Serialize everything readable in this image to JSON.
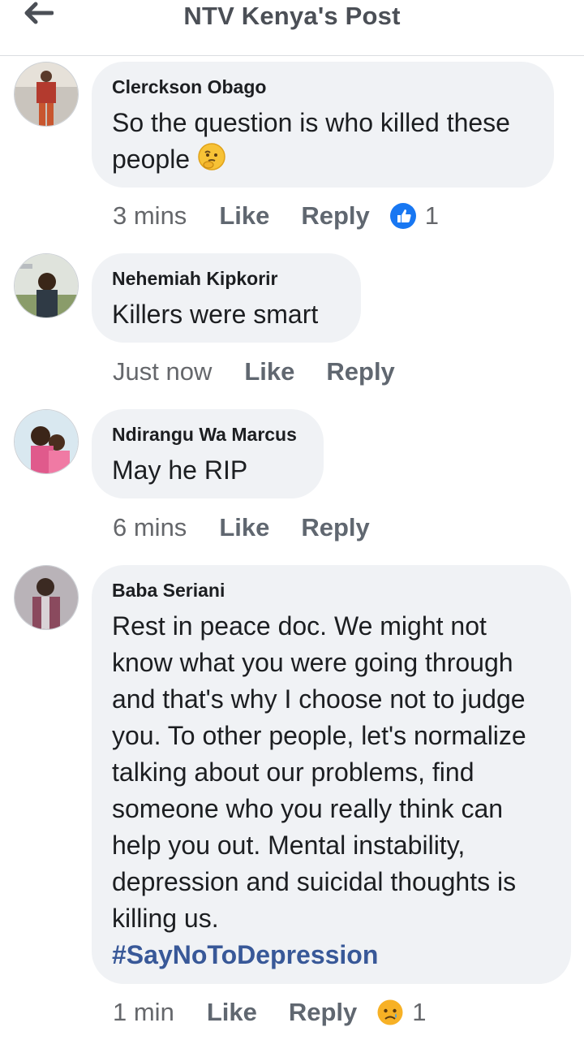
{
  "header": {
    "title": "NTV Kenya's Post",
    "back_icon": "arrow-left-icon"
  },
  "comments": [
    {
      "author": "Clerckson Obago",
      "text": "So the question is who killed these people",
      "emoji": "thinking-face-icon",
      "time": "3 mins",
      "like": "Like",
      "reply": "Reply",
      "reaction": {
        "icon": "like-icon",
        "count": "1",
        "color": "#1877f2"
      }
    },
    {
      "author": "Nehemiah Kipkorir",
      "text": "Killers were smart",
      "time": "Just now",
      "like": "Like",
      "reply": "Reply"
    },
    {
      "author": "Ndirangu Wa Marcus",
      "text": "May he RIP",
      "time": "6 mins",
      "like": "Like",
      "reply": "Reply"
    },
    {
      "author": "Baba Seriani",
      "text": "Rest in peace doc. We might not know what you were going through and that's why I choose not to judge you. To other people, let's normalize talking about our problems, find someone who you really think can help you out. Mental instability, depression and suicidal thoughts is killing us.",
      "hashtag": "#SayNoToDepression",
      "time": "1 min",
      "like": "Like",
      "reply": "Reply",
      "reaction": {
        "icon": "sad-face-icon",
        "count": "1",
        "color": "#f7b125"
      }
    }
  ]
}
